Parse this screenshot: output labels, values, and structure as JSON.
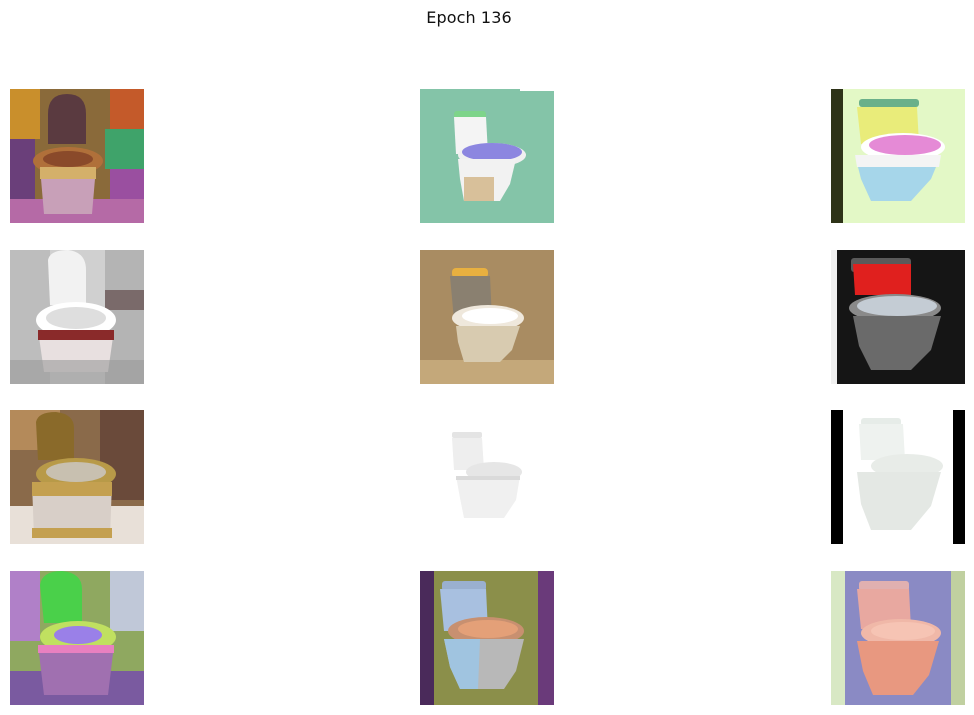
{
  "figure": {
    "title": "Epoch 136"
  },
  "grid": {
    "rows": 4,
    "cols": 3,
    "tiles": [
      {
        "row": 1,
        "col": 1,
        "desc": "ornate-toilet-colorful-tiles",
        "bg": "#a07a3a"
      },
      {
        "row": 1,
        "col": 2,
        "desc": "toilet-purple-seat-teal-bg",
        "bg": "#84c4a8"
      },
      {
        "row": 1,
        "col": 3,
        "desc": "toilet-pink-seat-yellow-bg",
        "bg": "#e3f8c6"
      },
      {
        "row": 2,
        "col": 1,
        "desc": "white-toilet-marble-wall",
        "bg": "#d8d8d8"
      },
      {
        "row": 2,
        "col": 2,
        "desc": "sepia-toilet-blurred",
        "bg": "#a98c62"
      },
      {
        "row": 2,
        "col": 3,
        "desc": "toilet-red-tank-dark-bg",
        "bg": "#151515"
      },
      {
        "row": 3,
        "col": 1,
        "desc": "gold-toilet-bathroom",
        "bg": "#9a7a50"
      },
      {
        "row": 3,
        "col": 2,
        "desc": "white-toilet-white-bg",
        "bg": "#ffffff"
      },
      {
        "row": 3,
        "col": 3,
        "desc": "white-toilet-black-borders",
        "bg": "#ffffff"
      },
      {
        "row": 4,
        "col": 1,
        "desc": "psychedelic-green-toilet",
        "bg": "#8fa860"
      },
      {
        "row": 4,
        "col": 2,
        "desc": "olive-toilet-purple-edges",
        "bg": "#8b8f4a"
      },
      {
        "row": 4,
        "col": 3,
        "desc": "pastel-pink-toilet-blue-bg",
        "bg": "#8a8ac4"
      }
    ]
  }
}
